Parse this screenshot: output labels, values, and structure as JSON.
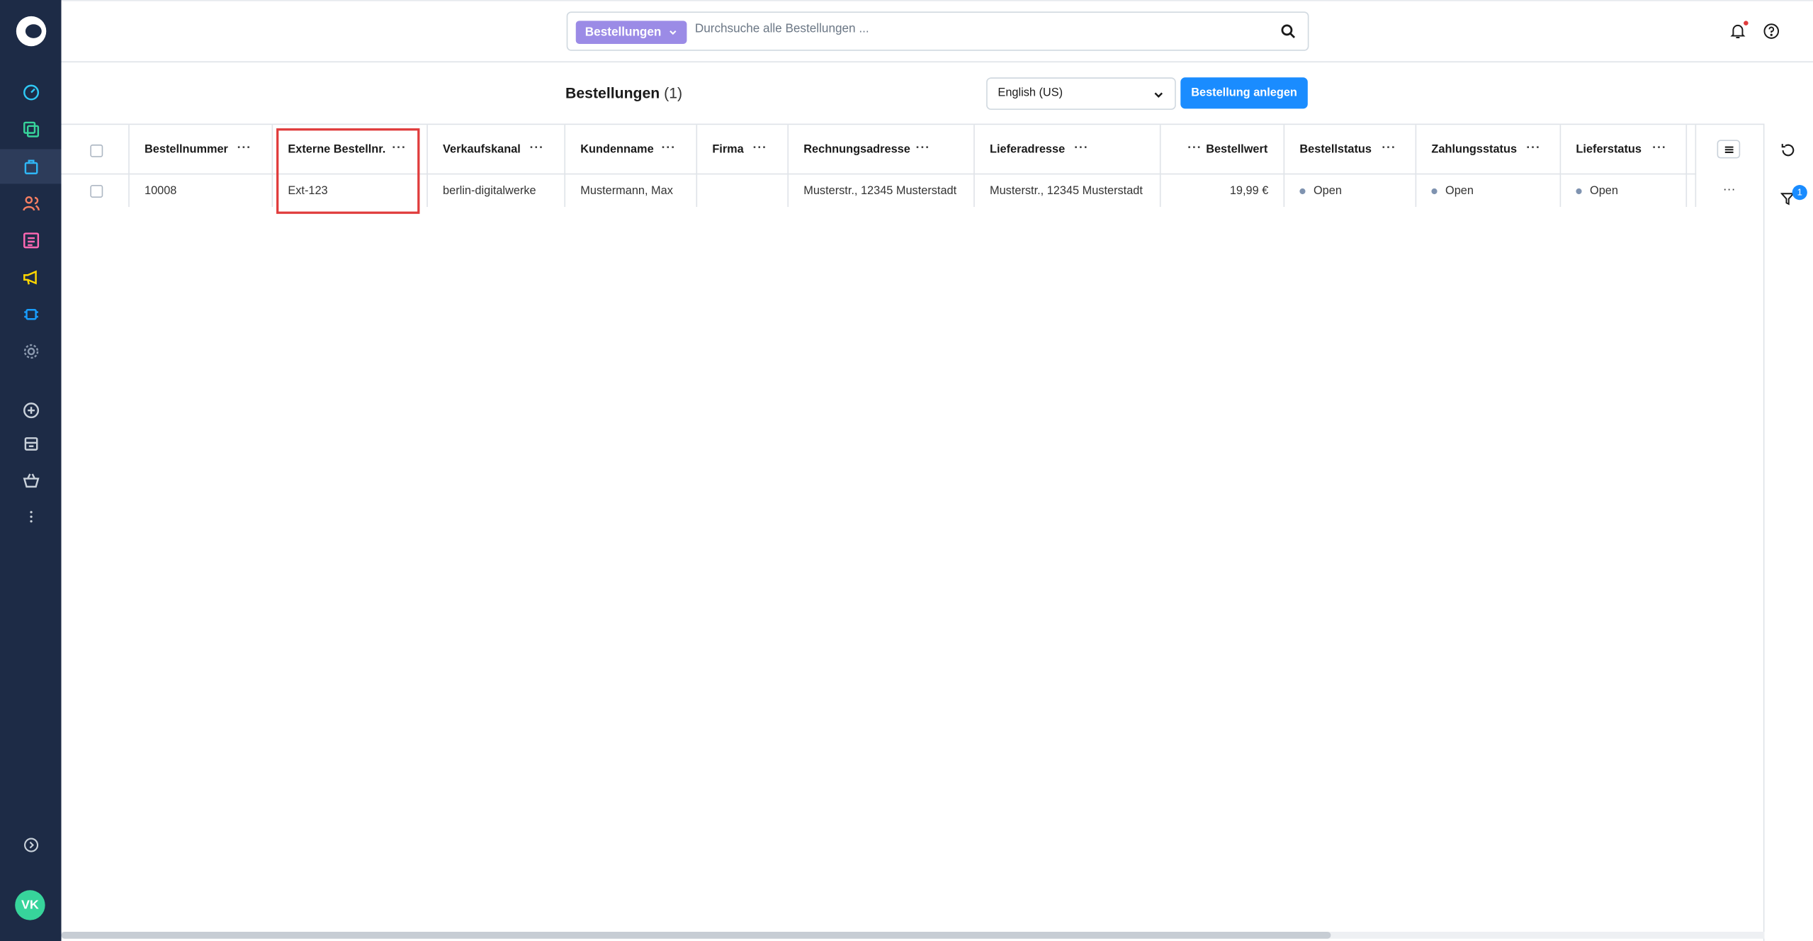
{
  "search": {
    "entity_label": "Bestellungen",
    "placeholder": "Durchsuche alle Bestellungen ..."
  },
  "page": {
    "title": "Bestellungen",
    "count": "(1)"
  },
  "language_select": {
    "value": "English (US)"
  },
  "create_button": {
    "label": "Bestellung anlegen"
  },
  "table": {
    "columns": [
      {
        "key": "bestellnummer",
        "label": "Bestellnummer"
      },
      {
        "key": "extern",
        "label": "Externe Bestellnr."
      },
      {
        "key": "verkaufskanal",
        "label": "Verkaufskanal"
      },
      {
        "key": "kundenname",
        "label": "Kundenname"
      },
      {
        "key": "firma",
        "label": "Firma"
      },
      {
        "key": "rechnungsadresse",
        "label": "Rechnungsadresse"
      },
      {
        "key": "lieferadresse",
        "label": "Lieferadresse"
      },
      {
        "key": "bestellwert",
        "label": "Bestellwert"
      },
      {
        "key": "bestellstatus",
        "label": "Bestellstatus"
      },
      {
        "key": "zahlungsstatus",
        "label": "Zahlungsstatus"
      },
      {
        "key": "lieferstatus",
        "label": "Lieferstatus"
      }
    ],
    "rows": [
      {
        "bestellnummer": "10008",
        "extern": "Ext-123",
        "verkaufskanal": "berlin-digitalwerke",
        "kundenname": "Mustermann, Max",
        "firma": "",
        "rechnungsadresse": "Musterstr., 12345 Musterstadt",
        "lieferadresse": "Musterstr., 12345 Musterstadt",
        "bestellwert": "19,99 €",
        "bestellstatus": "Open",
        "zahlungsstatus": "Open",
        "lieferstatus": "Open"
      }
    ]
  },
  "sidebar": {
    "avatar_initials": "VK",
    "items": [
      {
        "icon": "dashboard-icon"
      },
      {
        "icon": "catalog-icon"
      },
      {
        "icon": "orders-icon",
        "active": true
      },
      {
        "icon": "customers-icon"
      },
      {
        "icon": "content-icon"
      },
      {
        "icon": "marketing-icon"
      },
      {
        "icon": "extensions-icon"
      },
      {
        "icon": "settings-icon"
      },
      {
        "icon": "add-sales-channel-icon"
      },
      {
        "icon": "storefront-icon"
      },
      {
        "icon": "basket-icon"
      },
      {
        "icon": "more-icon"
      },
      {
        "icon": "expand-sidebar-icon"
      }
    ]
  },
  "filter_badge": "1",
  "colors": {
    "sidebar_bg": "#1d2b46",
    "primary": "#1a8cff",
    "search_tag": "#9b8be6",
    "highlight": "#e03c3c",
    "avatar": "#37d49b"
  }
}
